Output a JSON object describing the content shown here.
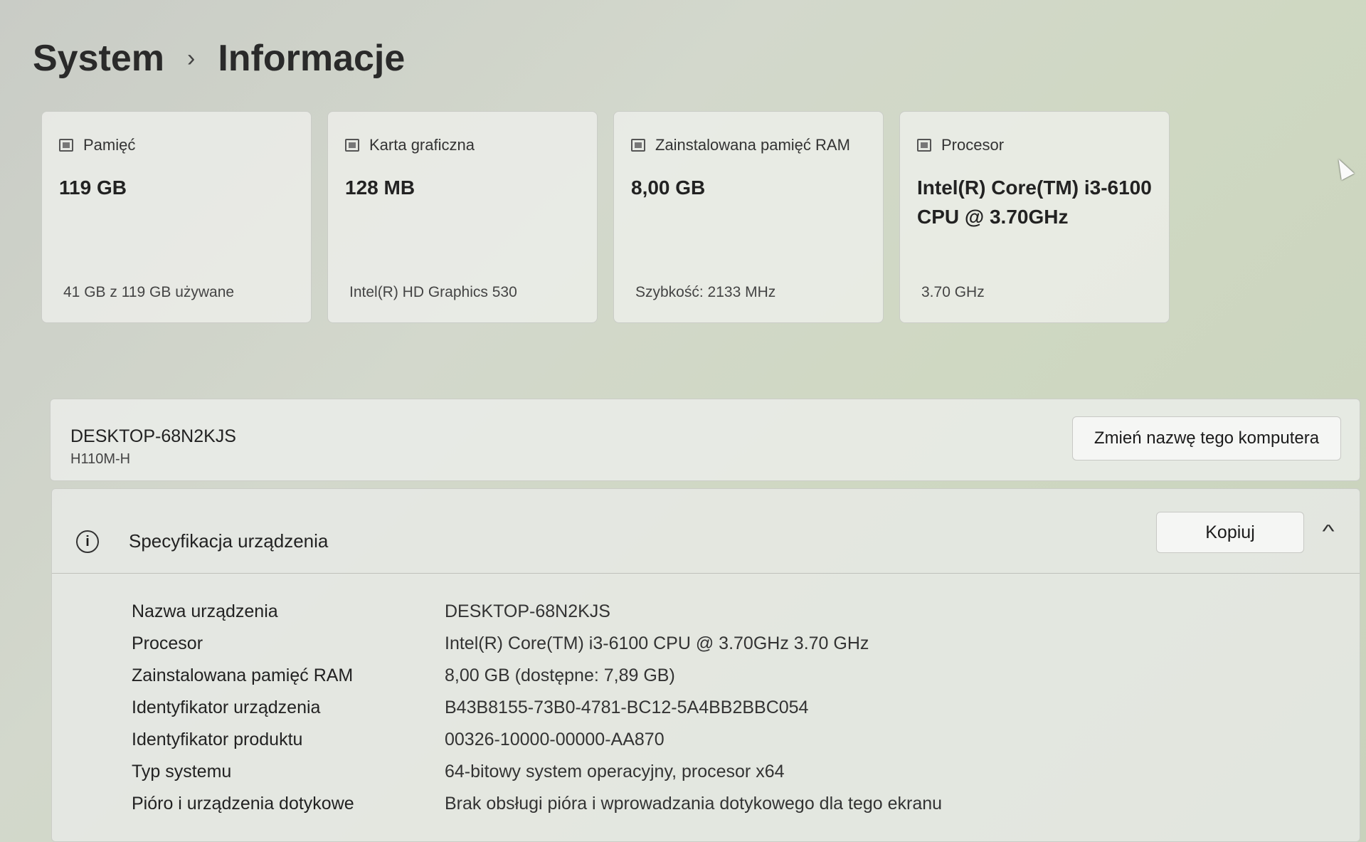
{
  "breadcrumb": {
    "parent": "System",
    "separator": "›",
    "current": "Informacje"
  },
  "cards": [
    {
      "icon": "storage-icon",
      "label": "Pamięć",
      "value": "119 GB",
      "detail": "41 GB z 119 GB używane"
    },
    {
      "icon": "graphics-card-icon",
      "label": "Karta graficzna",
      "value": "128 MB",
      "detail": "Intel(R) HD Graphics 530"
    },
    {
      "icon": "ram-icon",
      "label": "Zainstalowana pamięć RAM",
      "value": "8,00 GB",
      "detail": "Szybkość: 2133 MHz"
    },
    {
      "icon": "processor-icon",
      "label": "Procesor",
      "value": "Intel(R) Core(TM) i3-6100 CPU @ 3.70GHz",
      "detail": "3.70 GHz"
    }
  ],
  "device": {
    "name": "DESKTOP-68N2KJS",
    "model": "H110M-H",
    "rename_button": "Zmień nazwę tego komputera"
  },
  "specs": {
    "title": "Specyfikacja urządzenia",
    "copy_button": "Kopiuj",
    "rows": [
      {
        "label": "Nazwa urządzenia",
        "value": "DESKTOP-68N2KJS"
      },
      {
        "label": "Procesor",
        "value": "Intel(R) Core(TM) i3-6100 CPU @ 3.70GHz   3.70 GHz"
      },
      {
        "label": "Zainstalowana pamięć RAM",
        "value": "8,00 GB (dostępne: 7,89 GB)"
      },
      {
        "label": "Identyfikator urządzenia",
        "value": "B43B8155-73B0-4781-BC12-5A4BB2BBC054"
      },
      {
        "label": "Identyfikator produktu",
        "value": "00326-10000-00000-AA870"
      },
      {
        "label": "Typ systemu",
        "value": "64-bitowy system operacyjny, procesor x64"
      },
      {
        "label": "Pióro i urządzenia dotykowe",
        "value": "Brak obsługi pióra i wprowadzania dotykowego dla tego ekranu"
      }
    ]
  }
}
